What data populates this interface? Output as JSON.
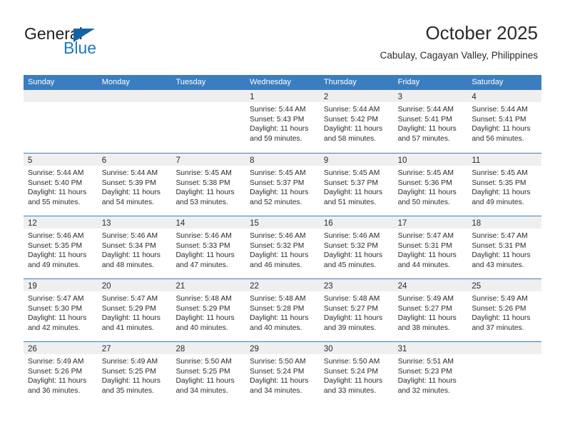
{
  "brand": {
    "name_part1": "General",
    "name_part2": "Blue",
    "triangle_color": "#1464a5",
    "blue_color": "#1b7bc0"
  },
  "header": {
    "month_title": "October 2025",
    "location": "Cabulay, Cagayan Valley, Philippines"
  },
  "theme": {
    "header_bar_color": "#3b7ebf",
    "day_band_color": "#efeff0",
    "text_color": "#2b2b2b"
  },
  "weekdays": [
    "Sunday",
    "Monday",
    "Tuesday",
    "Wednesday",
    "Thursday",
    "Friday",
    "Saturday"
  ],
  "weeks": [
    [
      {
        "day": "",
        "empty": true
      },
      {
        "day": "",
        "empty": true
      },
      {
        "day": "",
        "empty": true
      },
      {
        "day": "1",
        "sunrise": "Sunrise: 5:44 AM",
        "sunset": "Sunset: 5:43 PM",
        "daylight": "Daylight: 11 hours and 59 minutes."
      },
      {
        "day": "2",
        "sunrise": "Sunrise: 5:44 AM",
        "sunset": "Sunset: 5:42 PM",
        "daylight": "Daylight: 11 hours and 58 minutes."
      },
      {
        "day": "3",
        "sunrise": "Sunrise: 5:44 AM",
        "sunset": "Sunset: 5:41 PM",
        "daylight": "Daylight: 11 hours and 57 minutes."
      },
      {
        "day": "4",
        "sunrise": "Sunrise: 5:44 AM",
        "sunset": "Sunset: 5:41 PM",
        "daylight": "Daylight: 11 hours and 56 minutes."
      }
    ],
    [
      {
        "day": "5",
        "sunrise": "Sunrise: 5:44 AM",
        "sunset": "Sunset: 5:40 PM",
        "daylight": "Daylight: 11 hours and 55 minutes."
      },
      {
        "day": "6",
        "sunrise": "Sunrise: 5:44 AM",
        "sunset": "Sunset: 5:39 PM",
        "daylight": "Daylight: 11 hours and 54 minutes."
      },
      {
        "day": "7",
        "sunrise": "Sunrise: 5:45 AM",
        "sunset": "Sunset: 5:38 PM",
        "daylight": "Daylight: 11 hours and 53 minutes."
      },
      {
        "day": "8",
        "sunrise": "Sunrise: 5:45 AM",
        "sunset": "Sunset: 5:37 PM",
        "daylight": "Daylight: 11 hours and 52 minutes."
      },
      {
        "day": "9",
        "sunrise": "Sunrise: 5:45 AM",
        "sunset": "Sunset: 5:37 PM",
        "daylight": "Daylight: 11 hours and 51 minutes."
      },
      {
        "day": "10",
        "sunrise": "Sunrise: 5:45 AM",
        "sunset": "Sunset: 5:36 PM",
        "daylight": "Daylight: 11 hours and 50 minutes."
      },
      {
        "day": "11",
        "sunrise": "Sunrise: 5:45 AM",
        "sunset": "Sunset: 5:35 PM",
        "daylight": "Daylight: 11 hours and 49 minutes."
      }
    ],
    [
      {
        "day": "12",
        "sunrise": "Sunrise: 5:46 AM",
        "sunset": "Sunset: 5:35 PM",
        "daylight": "Daylight: 11 hours and 49 minutes."
      },
      {
        "day": "13",
        "sunrise": "Sunrise: 5:46 AM",
        "sunset": "Sunset: 5:34 PM",
        "daylight": "Daylight: 11 hours and 48 minutes."
      },
      {
        "day": "14",
        "sunrise": "Sunrise: 5:46 AM",
        "sunset": "Sunset: 5:33 PM",
        "daylight": "Daylight: 11 hours and 47 minutes."
      },
      {
        "day": "15",
        "sunrise": "Sunrise: 5:46 AM",
        "sunset": "Sunset: 5:32 PM",
        "daylight": "Daylight: 11 hours and 46 minutes."
      },
      {
        "day": "16",
        "sunrise": "Sunrise: 5:46 AM",
        "sunset": "Sunset: 5:32 PM",
        "daylight": "Daylight: 11 hours and 45 minutes."
      },
      {
        "day": "17",
        "sunrise": "Sunrise: 5:47 AM",
        "sunset": "Sunset: 5:31 PM",
        "daylight": "Daylight: 11 hours and 44 minutes."
      },
      {
        "day": "18",
        "sunrise": "Sunrise: 5:47 AM",
        "sunset": "Sunset: 5:31 PM",
        "daylight": "Daylight: 11 hours and 43 minutes."
      }
    ],
    [
      {
        "day": "19",
        "sunrise": "Sunrise: 5:47 AM",
        "sunset": "Sunset: 5:30 PM",
        "daylight": "Daylight: 11 hours and 42 minutes."
      },
      {
        "day": "20",
        "sunrise": "Sunrise: 5:47 AM",
        "sunset": "Sunset: 5:29 PM",
        "daylight": "Daylight: 11 hours and 41 minutes."
      },
      {
        "day": "21",
        "sunrise": "Sunrise: 5:48 AM",
        "sunset": "Sunset: 5:29 PM",
        "daylight": "Daylight: 11 hours and 40 minutes."
      },
      {
        "day": "22",
        "sunrise": "Sunrise: 5:48 AM",
        "sunset": "Sunset: 5:28 PM",
        "daylight": "Daylight: 11 hours and 40 minutes."
      },
      {
        "day": "23",
        "sunrise": "Sunrise: 5:48 AM",
        "sunset": "Sunset: 5:27 PM",
        "daylight": "Daylight: 11 hours and 39 minutes."
      },
      {
        "day": "24",
        "sunrise": "Sunrise: 5:49 AM",
        "sunset": "Sunset: 5:27 PM",
        "daylight": "Daylight: 11 hours and 38 minutes."
      },
      {
        "day": "25",
        "sunrise": "Sunrise: 5:49 AM",
        "sunset": "Sunset: 5:26 PM",
        "daylight": "Daylight: 11 hours and 37 minutes."
      }
    ],
    [
      {
        "day": "26",
        "sunrise": "Sunrise: 5:49 AM",
        "sunset": "Sunset: 5:26 PM",
        "daylight": "Daylight: 11 hours and 36 minutes."
      },
      {
        "day": "27",
        "sunrise": "Sunrise: 5:49 AM",
        "sunset": "Sunset: 5:25 PM",
        "daylight": "Daylight: 11 hours and 35 minutes."
      },
      {
        "day": "28",
        "sunrise": "Sunrise: 5:50 AM",
        "sunset": "Sunset: 5:25 PM",
        "daylight": "Daylight: 11 hours and 34 minutes."
      },
      {
        "day": "29",
        "sunrise": "Sunrise: 5:50 AM",
        "sunset": "Sunset: 5:24 PM",
        "daylight": "Daylight: 11 hours and 34 minutes."
      },
      {
        "day": "30",
        "sunrise": "Sunrise: 5:50 AM",
        "sunset": "Sunset: 5:24 PM",
        "daylight": "Daylight: 11 hours and 33 minutes."
      },
      {
        "day": "31",
        "sunrise": "Sunrise: 5:51 AM",
        "sunset": "Sunset: 5:23 PM",
        "daylight": "Daylight: 11 hours and 32 minutes."
      },
      {
        "day": "",
        "empty": true
      }
    ]
  ]
}
